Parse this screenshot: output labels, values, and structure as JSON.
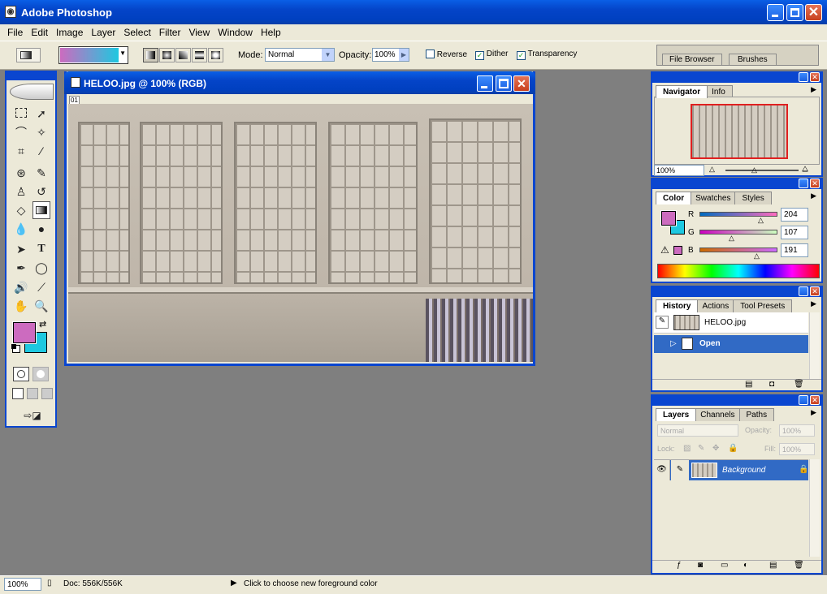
{
  "app": {
    "title": "Adobe Photoshop"
  },
  "menu": [
    "File",
    "Edit",
    "Image",
    "Layer",
    "Select",
    "Filter",
    "View",
    "Window",
    "Help"
  ],
  "options": {
    "mode_label": "Mode:",
    "mode_value": "Normal",
    "opacity_label": "Opacity:",
    "opacity_value": "100%",
    "reverse": "Reverse",
    "dither": "Dither",
    "transparency": "Transparency",
    "gradient_start": "#cc6bbf",
    "gradient_end": "#1ec8e0"
  },
  "well": {
    "file_browser": "File Browser",
    "brushes": "Brushes"
  },
  "document": {
    "title": "HELOO.jpg @ 100% (RGB)",
    "ruler": "01"
  },
  "navigator": {
    "tabs": [
      "Navigator",
      "Info"
    ],
    "zoom": "100%"
  },
  "color": {
    "tabs": [
      "Color",
      "Swatches",
      "Styles"
    ],
    "r_label": "R",
    "g_label": "G",
    "b_label": "B",
    "r": "204",
    "g": "107",
    "b": "191",
    "fg": "#cc6bbf",
    "bg": "#1ec8e0"
  },
  "history": {
    "tabs": [
      "History",
      "Actions",
      "Tool Presets"
    ],
    "snapshot": "HELOO.jpg",
    "step": "Open"
  },
  "layers": {
    "tabs": [
      "Layers",
      "Channels",
      "Paths"
    ],
    "mode": "Normal",
    "opacity_label": "Opacity:",
    "opacity": "100%",
    "lock_label": "Lock:",
    "fill_label": "Fill:",
    "fill": "100%",
    "layer_name": "Background"
  },
  "status": {
    "zoom": "100%",
    "doc": "Doc: 556K/556K",
    "hint": "Click to choose new foreground color"
  }
}
